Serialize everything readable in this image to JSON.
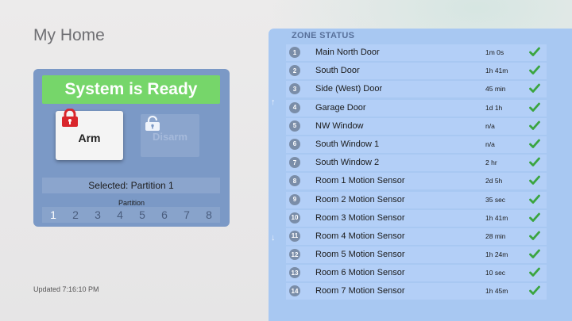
{
  "app": {
    "title": "My Home",
    "updated": "Updated 7:16:10 PM"
  },
  "security": {
    "status": "System is Ready",
    "arm_label": "Arm",
    "disarm_label": "Disarm",
    "selected_text": "Selected: Partition 1",
    "partition_label": "Partition",
    "partitions": [
      "1",
      "2",
      "3",
      "4",
      "5",
      "6",
      "7",
      "8"
    ],
    "active_partition": "1"
  },
  "zones": {
    "title": "ZONE STATUS",
    "items": [
      {
        "num": "1",
        "name": "Main North Door",
        "time": "1m 0s"
      },
      {
        "num": "2",
        "name": "South Door",
        "time": "1h 41m"
      },
      {
        "num": "3",
        "name": "Side (West) Door",
        "time": "45 min"
      },
      {
        "num": "4",
        "name": "Garage Door",
        "time": "1d 1h"
      },
      {
        "num": "5",
        "name": "NW Window",
        "time": "n/a"
      },
      {
        "num": "6",
        "name": "South Window 1",
        "time": "n/a"
      },
      {
        "num": "7",
        "name": "South Window 2",
        "time": "2 hr"
      },
      {
        "num": "8",
        "name": "Room 1 Motion Sensor",
        "time": "2d 5h"
      },
      {
        "num": "9",
        "name": "Room 2 Motion Sensor",
        "time": "35 sec"
      },
      {
        "num": "10",
        "name": "Room 3 Motion Sensor",
        "time": "1h 41m"
      },
      {
        "num": "11",
        "name": "Room 4 Motion Sensor",
        "time": "28 min"
      },
      {
        "num": "12",
        "name": "Room 5 Motion Sensor",
        "time": "1h 24m"
      },
      {
        "num": "13",
        "name": "Room 6 Motion Sensor",
        "time": "10 sec"
      },
      {
        "num": "14",
        "name": "Room 7 Motion Sensor",
        "time": "1h 45m"
      }
    ]
  },
  "icons": {
    "arm": "lock-icon",
    "disarm": "unlock-icon",
    "status": "check-icon",
    "scroll_up": "arrow-up-icon",
    "scroll_down": "arrow-down-icon"
  },
  "colors": {
    "ready": "#76d66a",
    "lock": "#d9262c",
    "check": "#3aa53f",
    "panel": "#7b99c6",
    "zone_panel": "#a8c8f2"
  }
}
